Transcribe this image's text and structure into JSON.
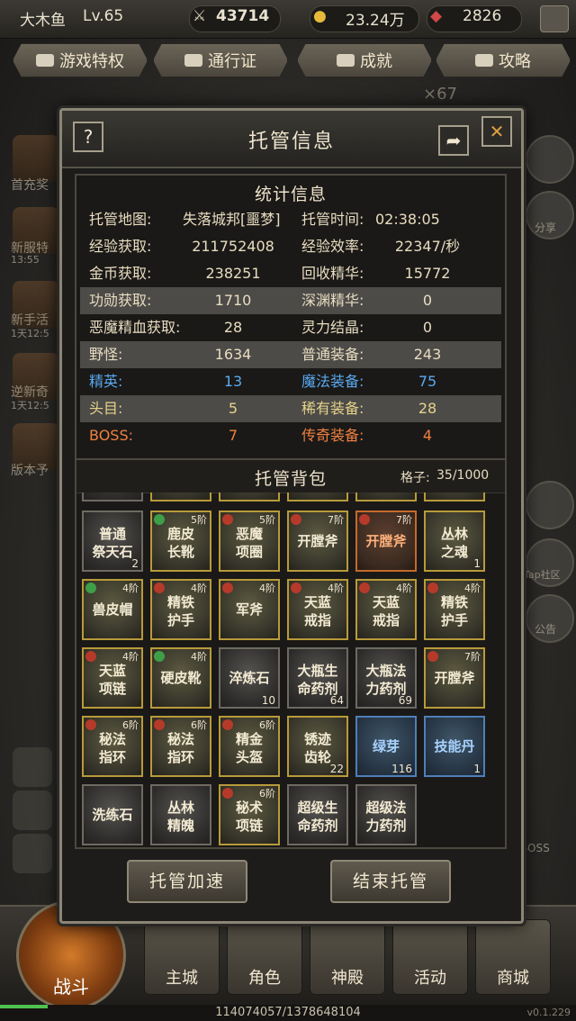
{
  "player": {
    "name": "大木鱼",
    "level": "Lv.65",
    "power": "43714",
    "gold": "23.24万",
    "gems": "2826"
  },
  "top_nav": [
    "游戏特权",
    "通行证",
    "成就",
    "攻略"
  ],
  "background": {
    "left_items": [
      "首充奖",
      "新服特",
      "新手活",
      "逆新奇",
      "版本予"
    ],
    "left_timers": [
      "13:55",
      "1天12:5",
      "1天12:5"
    ],
    "right_labels": [
      "分享",
      "Tap社区",
      "公告",
      "BOSS"
    ],
    "score_mult": "×67"
  },
  "modal": {
    "title": "托管信息",
    "help_icon": "?",
    "stats": {
      "title": "统计信息",
      "map_label": "托管地图:",
      "map_value": "失落城邦[噩梦]",
      "time_label": "托管时间:",
      "time_value": "02:38:05",
      "rows": [
        {
          "l1": "经验获取:",
          "v1": "211752408",
          "l2": "经验效率:",
          "v2": "22347/秒"
        },
        {
          "l1": "金币获取:",
          "v1": "238251",
          "l2": "回收精华:",
          "v2": "15772"
        },
        {
          "l1": "功勋获取:",
          "v1": "1710",
          "l2": "深渊精华:",
          "v2": "0"
        },
        {
          "l1": "恶魔精血获取:",
          "v1": "28",
          "l2": "灵力结晶:",
          "v2": "0"
        },
        {
          "l1": "野怪:",
          "v1": "1634",
          "l2": "普通装备:",
          "v2": "243"
        },
        {
          "l1": "精英:",
          "v1": "13",
          "l2": "魔法装备:",
          "v2": "75"
        },
        {
          "l1": "头目:",
          "v1": "5",
          "l2": "稀有装备:",
          "v2": "28"
        },
        {
          "l1": "BOSS:",
          "v1": "7",
          "l2": "传奇装备:",
          "v2": "4"
        }
      ],
      "colors": {
        "white": "#e8dcc0",
        "blue": "#5aa9f0",
        "yellow": "#e6d38a",
        "orange": "#f08040"
      }
    },
    "bag": {
      "title": "托管背包",
      "capacity_label": "格子:",
      "capacity": "35/1000",
      "rows": [
        [
          {
            "name": "普通祭天石",
            "tier": "",
            "count": "2",
            "style": "grey",
            "badge": ""
          },
          {
            "name": "鹿皮长靴",
            "tier": "5阶",
            "count": "",
            "style": "gold",
            "badge": "g"
          },
          {
            "name": "恶魔项圈",
            "tier": "5阶",
            "count": "",
            "style": "gold",
            "badge": "r"
          },
          {
            "name": "开膛斧",
            "tier": "7阶",
            "count": "",
            "style": "gold",
            "badge": "r"
          },
          {
            "name": "开膛斧",
            "tier": "7阶",
            "count": "",
            "style": "orange",
            "badge": "r"
          },
          {
            "name": "丛林之魂",
            "tier": "",
            "count": "1",
            "style": "gold",
            "badge": ""
          }
        ],
        [
          {
            "name": "兽皮帽",
            "tier": "4阶",
            "count": "",
            "style": "gold",
            "badge": "g"
          },
          {
            "name": "精铁护手",
            "tier": "4阶",
            "count": "",
            "style": "gold",
            "badge": "r"
          },
          {
            "name": "军斧",
            "tier": "4阶",
            "count": "",
            "style": "gold",
            "badge": "r"
          },
          {
            "name": "天蓝戒指",
            "tier": "4阶",
            "count": "",
            "style": "gold",
            "badge": "r"
          },
          {
            "name": "天蓝戒指",
            "tier": "4阶",
            "count": "",
            "style": "gold",
            "badge": "r"
          },
          {
            "name": "精铁护手",
            "tier": "4阶",
            "count": "",
            "style": "gold",
            "badge": "r"
          }
        ],
        [
          {
            "name": "天蓝项链",
            "tier": "4阶",
            "count": "",
            "style": "gold",
            "badge": "r"
          },
          {
            "name": "硬皮靴",
            "tier": "4阶",
            "count": "",
            "style": "gold",
            "badge": "g"
          },
          {
            "name": "淬炼石",
            "tier": "",
            "count": "10",
            "style": "grey",
            "badge": ""
          },
          {
            "name": "大瓶生命药剂",
            "tier": "",
            "count": "64",
            "style": "grey",
            "badge": ""
          },
          {
            "name": "大瓶法力药剂",
            "tier": "",
            "count": "69",
            "style": "grey",
            "badge": ""
          },
          {
            "name": "开膛斧",
            "tier": "7阶",
            "count": "",
            "style": "gold",
            "badge": "r"
          }
        ],
        [
          {
            "name": "秘法指环",
            "tier": "6阶",
            "count": "",
            "style": "gold",
            "badge": "r"
          },
          {
            "name": "秘法指环",
            "tier": "6阶",
            "count": "",
            "style": "gold",
            "badge": "r"
          },
          {
            "name": "精金头盔",
            "tier": "6阶",
            "count": "",
            "style": "gold",
            "badge": "r"
          },
          {
            "name": "锈迹齿轮",
            "tier": "",
            "count": "22",
            "style": "gold",
            "badge": ""
          },
          {
            "name": "绿芽",
            "tier": "",
            "count": "116",
            "style": "blue",
            "badge": ""
          },
          {
            "name": "技能丹",
            "tier": "",
            "count": "1",
            "style": "blue",
            "badge": ""
          }
        ],
        [
          {
            "name": "洗练石",
            "tier": "",
            "count": "",
            "style": "grey",
            "badge": ""
          },
          {
            "name": "丛林精魄",
            "tier": "",
            "count": "",
            "style": "grey",
            "badge": ""
          },
          {
            "name": "秘术项链",
            "tier": "6阶",
            "count": "",
            "style": "gold",
            "badge": "r"
          },
          {
            "name": "超级生命药剂",
            "tier": "",
            "count": "",
            "style": "grey",
            "badge": ""
          },
          {
            "name": "超级法力药剂",
            "tier": "",
            "count": "",
            "style": "grey",
            "badge": ""
          }
        ]
      ]
    },
    "buttons": {
      "speedup": "托管加速",
      "end": "结束托管"
    }
  },
  "bottom_nav": {
    "battle": "战斗",
    "items": [
      "主城",
      "角色",
      "神殿",
      "活动",
      "商城"
    ]
  },
  "exp": {
    "text": "114074057/1378648104",
    "progress": 0.083
  },
  "version": "v0.1.229"
}
